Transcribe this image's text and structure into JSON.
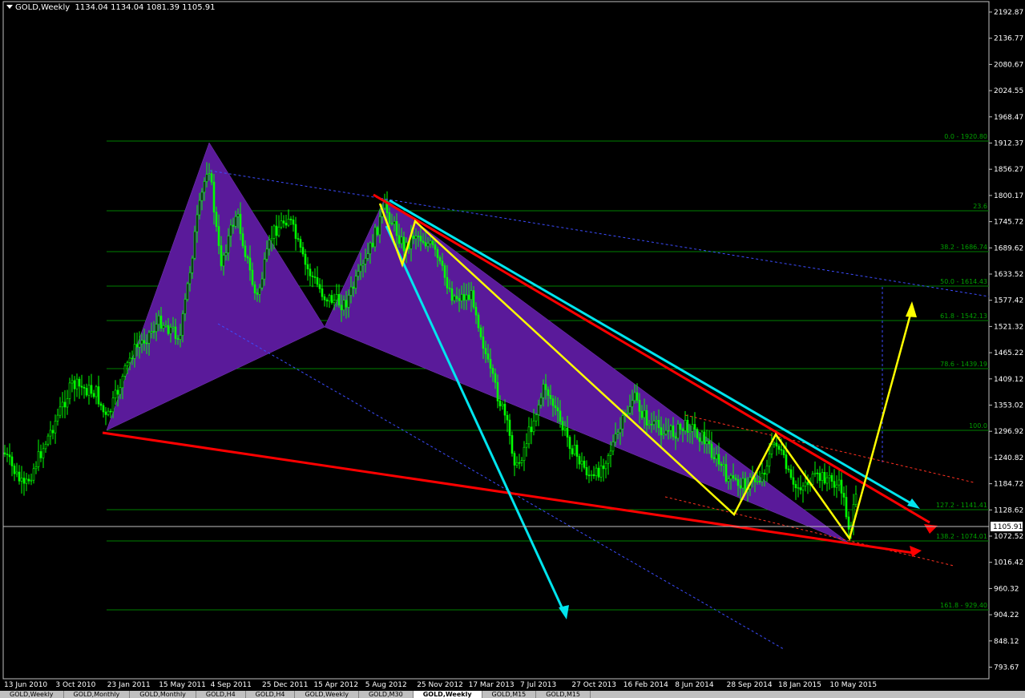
{
  "header": {
    "symbol": "GOLD,Weekly",
    "ohlc": "1134.04 1134.04 1081.39 1105.91"
  },
  "chart_data": {
    "type": "candlestick",
    "price_axis": [
      "2192.87",
      "2136.77",
      "2080.67",
      "2024.55",
      "1968.47",
      "1912.37",
      "1856.27",
      "1800.17",
      "1745.72",
      "1689.62",
      "1633.52",
      "1577.42",
      "1521.32",
      "1465.22",
      "1409.12",
      "1353.02",
      "1296.92",
      "1240.82",
      "1184.72",
      "1128.62",
      "1072.52",
      "1016.42",
      "960.32",
      "904.22",
      "848.12",
      "793.67"
    ],
    "current_price": "1105.91",
    "date_axis": [
      "13 Jun 2010",
      "3 Oct 2010",
      "23 Jan 2011",
      "15 May 2011",
      "4 Sep 2011",
      "25 Dec 2011",
      "15 Apr 2012",
      "5 Aug 2012",
      "25 Nov 2012",
      "17 Mar 2013",
      "7 Jul 2013",
      "27 Oct 2013",
      "16 Feb 2014",
      "8 Jun 2014",
      "28 Sep 2014",
      "18 Jan 2015",
      "10 May 2015"
    ],
    "fib_levels": [
      "0.0 - 1920.80",
      "23.6",
      "38.2 - 1686.74",
      "50.0 - 1614.43",
      "61.8 - 1542.13",
      "78.6 - 1439.19",
      "100.0",
      "127.2 - 1141.41",
      "138.2 - 1074.01",
      "161.8 - 929.40"
    ],
    "colors": {
      "candles": "#00ff00",
      "fib": "#008000",
      "pattern": "#5a1a9a",
      "zigzag": "#ffff00",
      "trend_red": "#ff0000",
      "trend_cyan": "#00e5ee",
      "dash_blue": "#3c4cff"
    }
  },
  "tabs": [
    "GOLD,Weekly",
    "GOLD,Monthly",
    "GOLD,Monthly",
    "GOLD,H4",
    "GOLD,H4",
    "GOLD,Weekly",
    "GOLD,M30",
    "GOLD,Weekly",
    "GOLD,M15",
    "GOLD,M15"
  ]
}
